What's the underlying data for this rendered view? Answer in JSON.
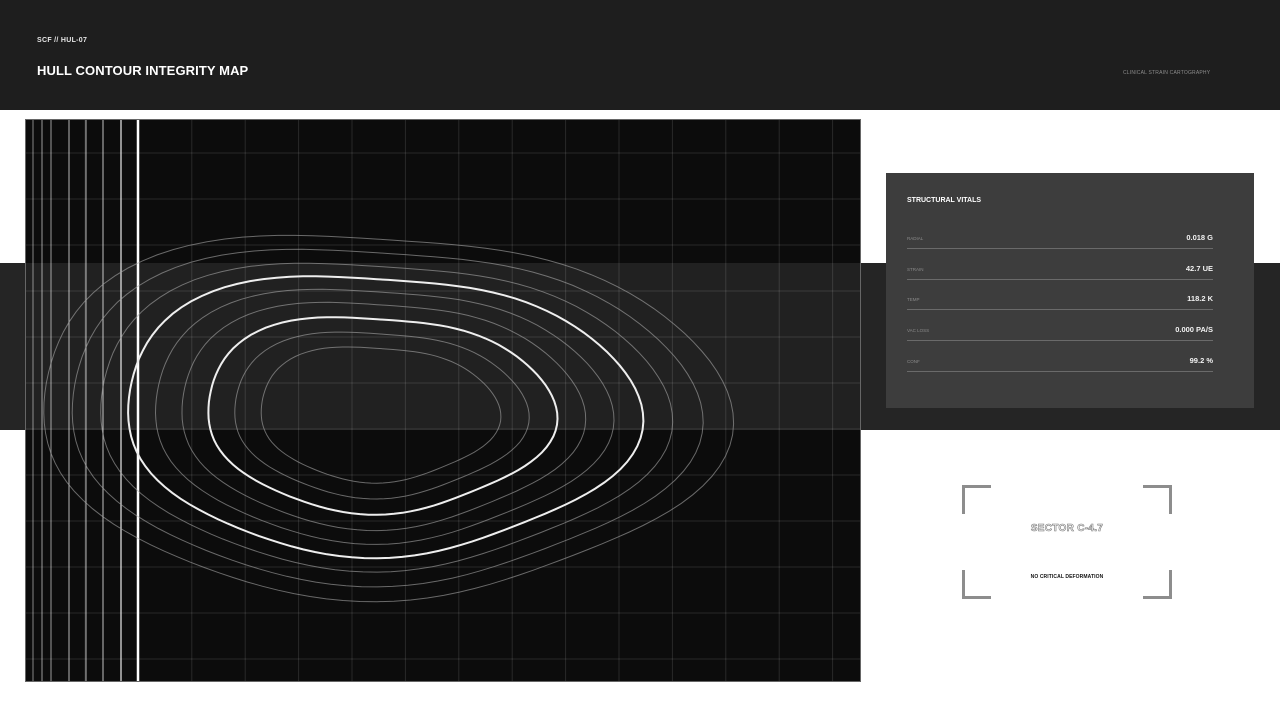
{
  "header": {
    "code": "SCF // HUL-07",
    "title": "HULL CONTOUR INTEGRITY MAP",
    "subtitle": "CLINICAL STRAIN CARTOGRAPHY"
  },
  "vitals": {
    "title": "STRUCTURAL VITALS",
    "rows": [
      {
        "label": "RADIAL",
        "value": "0.018 G"
      },
      {
        "label": "STRAIN",
        "value": "42.7 UE"
      },
      {
        "label": "TEMP",
        "value": "118.2 K"
      },
      {
        "label": "VAC LOSS",
        "value": "0.000 PA/S"
      },
      {
        "label": "CONF",
        "value": "99.2 %"
      }
    ]
  },
  "sector": {
    "label": "SECTOR C-4.7",
    "status": "NO CRITICAL DEFORMATION"
  },
  "colors": {
    "header_bg": "#1e1e1e",
    "band_bg": "#252525",
    "map_bg": "#0c0c0c",
    "panel_bg": "#3d3d3d",
    "contour_major": "#eeeeee",
    "contour_minor": "#a8a8a8"
  }
}
